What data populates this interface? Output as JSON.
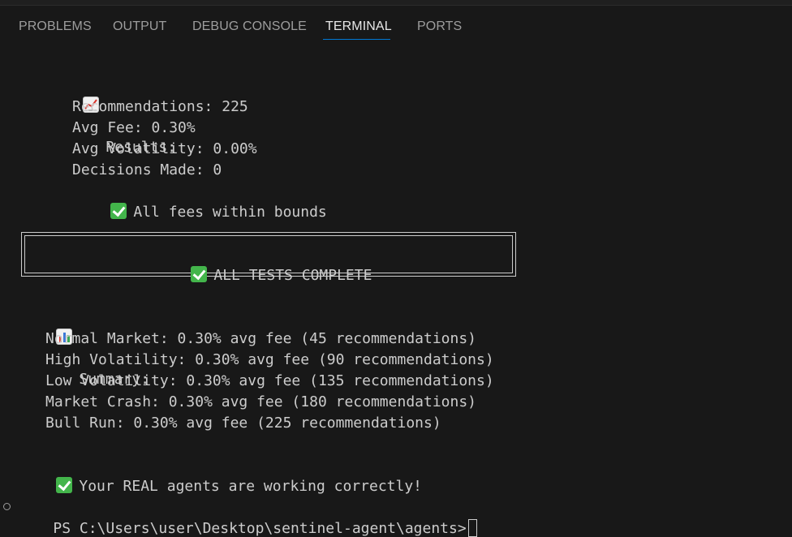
{
  "panel": {
    "tabs": [
      {
        "label": "PROBLEMS"
      },
      {
        "label": "OUTPUT"
      },
      {
        "label": "DEBUG CONSOLE"
      },
      {
        "label": "TERMINAL",
        "active": true
      },
      {
        "label": "PORTS"
      }
    ],
    "accent_color": "#0078d4"
  },
  "terminal": {
    "results_header": "Results:",
    "recommendations": "Recommendations: 225",
    "avg_fee": "Avg Fee: 0.30%",
    "avg_volatility": "Avg Volatility: 0.00%",
    "decisions_made": "Decisions Made: 0",
    "fees_check": "All fees within bounds",
    "banner": "ALL TESTS COMPLETE",
    "summary_header": "Summary:",
    "summary_lines": [
      "Normal Market: 0.30% avg fee (45 recommendations)",
      "High Volatility: 0.30% avg fee (90 recommendations)",
      "Low Volatility: 0.30% avg fee (135 recommendations)",
      "Market Crash: 0.30% avg fee (180 recommendations)",
      "Bull Run: 0.30% avg fee (225 recommendations)"
    ],
    "final_message": "Your REAL agents are working correctly!",
    "prompt": "PS C:\\Users\\user\\Desktop\\sentinel-agent\\agents>",
    "icons": {
      "results": "chart-increasing-icon",
      "check": "check-mark-button-icon",
      "summary": "bar-chart-icon"
    }
  }
}
